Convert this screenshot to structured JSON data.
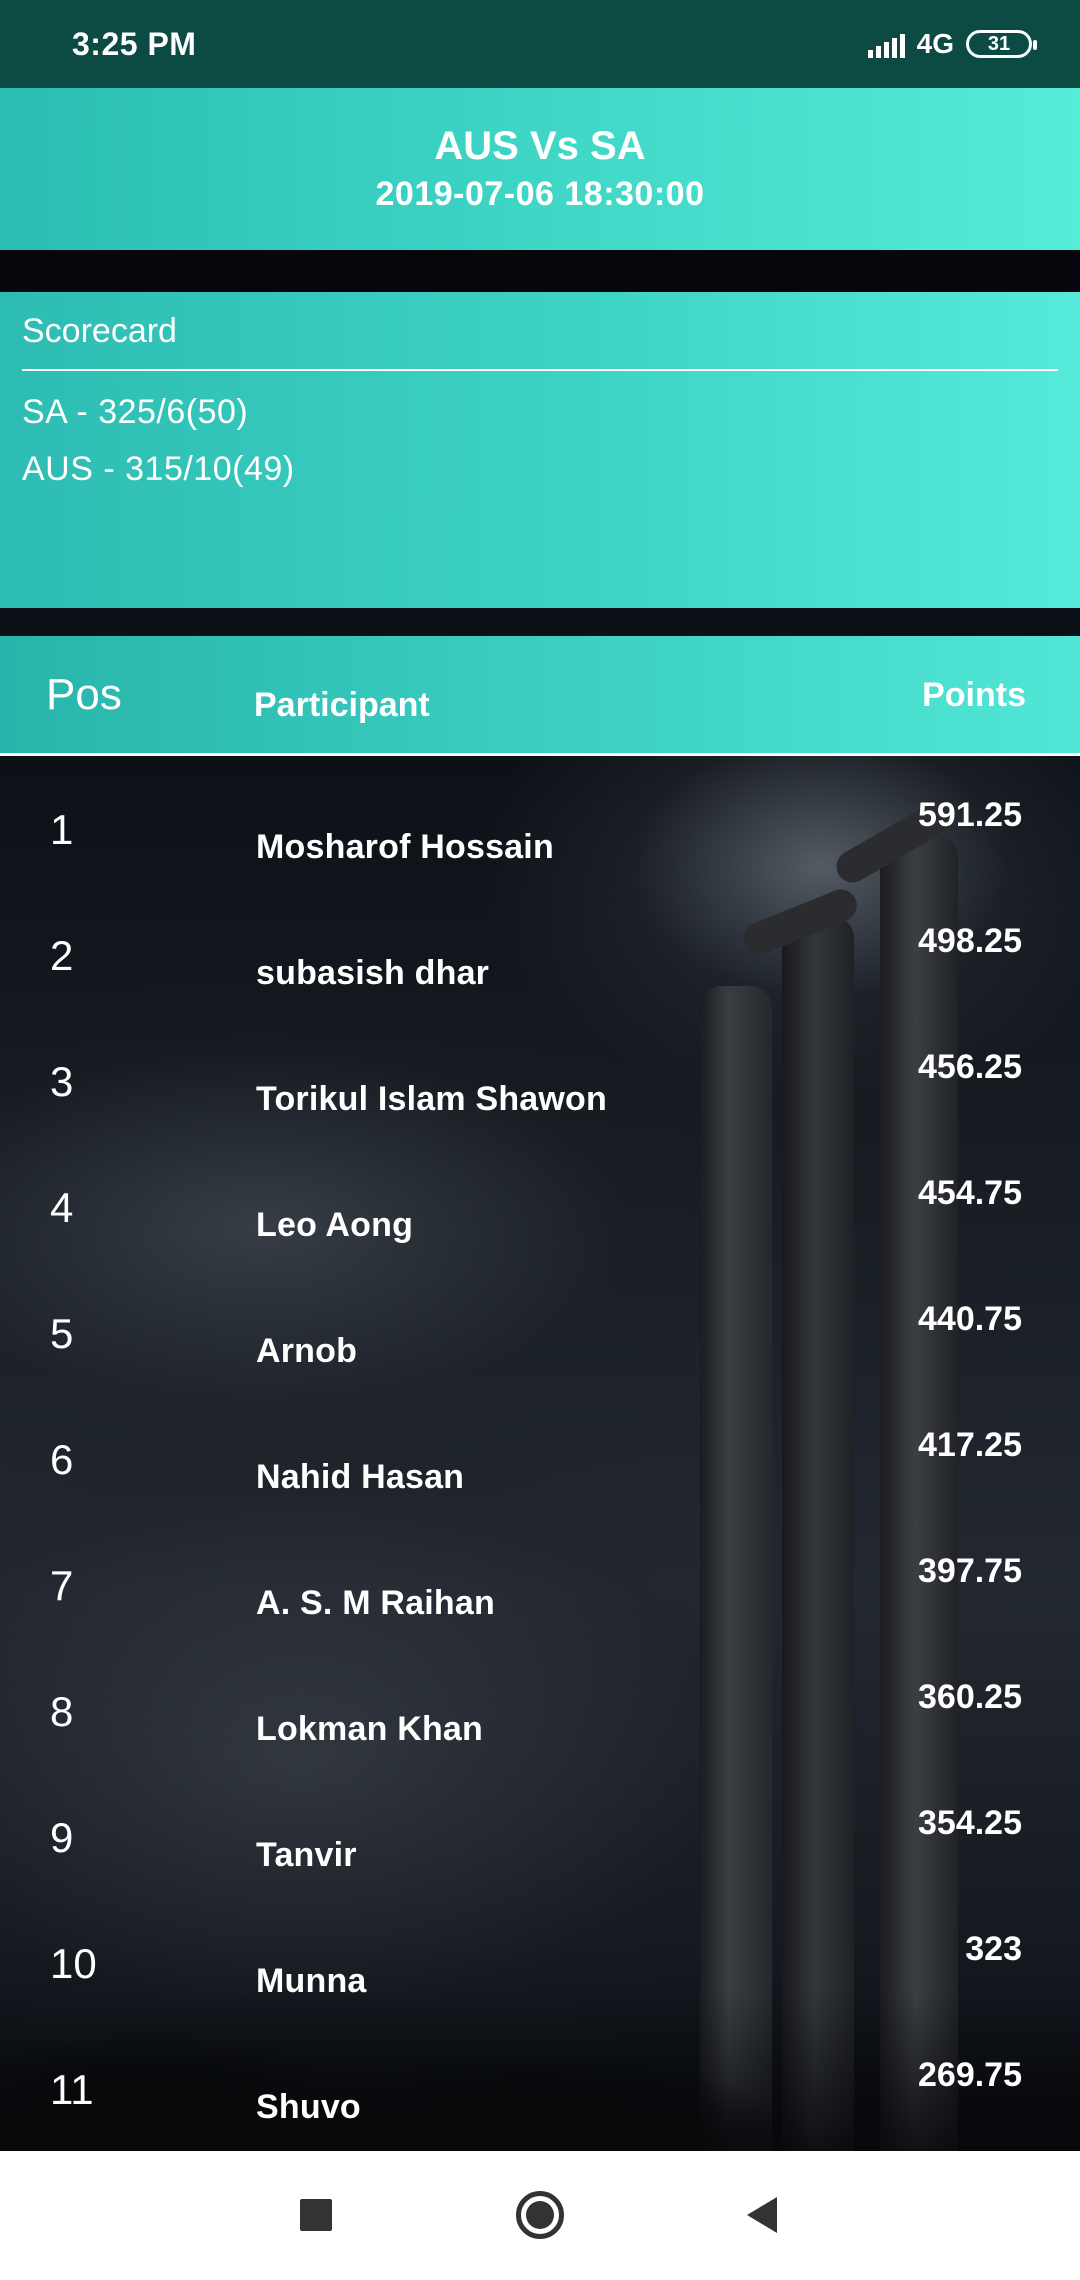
{
  "status_bar": {
    "time": "3:25 PM",
    "network": "4G",
    "battery": "31"
  },
  "match": {
    "title": "AUS Vs SA",
    "datetime": "2019-07-06 18:30:00"
  },
  "scorecard": {
    "title": "Scorecard",
    "lines": [
      "SA - 325/6(50)",
      "AUS - 315/10(49)"
    ]
  },
  "leaderboard": {
    "headers": {
      "pos": "Pos",
      "participant": "Participant",
      "points": "Points"
    },
    "rows": [
      {
        "pos": "1",
        "name": "Mosharof Hossain",
        "points": "591.25"
      },
      {
        "pos": "2",
        "name": "subasish dhar",
        "points": "498.25"
      },
      {
        "pos": "3",
        "name": "Torikul Islam Shawon",
        "points": "456.25"
      },
      {
        "pos": "4",
        "name": "Leo Aong",
        "points": "454.75"
      },
      {
        "pos": "5",
        "name": "Arnob",
        "points": "440.75"
      },
      {
        "pos": "6",
        "name": "Nahid Hasan",
        "points": "417.25"
      },
      {
        "pos": "7",
        "name": "A. S. M Raihan",
        "points": "397.75"
      },
      {
        "pos": "8",
        "name": "Lokman Khan",
        "points": "360.25"
      },
      {
        "pos": "9",
        "name": "Tanvir",
        "points": "354.25"
      },
      {
        "pos": "10",
        "name": "Munna",
        "points": "323"
      },
      {
        "pos": "11",
        "name": "Shuvo",
        "points": "269.75"
      }
    ]
  },
  "colors": {
    "status_bar": "#0c4a44",
    "accent_start": "#2bbdb3",
    "accent_end": "#55ecd8"
  },
  "nav": {
    "icons": [
      "square-recents-icon",
      "circle-home-icon",
      "triangle-back-icon"
    ]
  }
}
